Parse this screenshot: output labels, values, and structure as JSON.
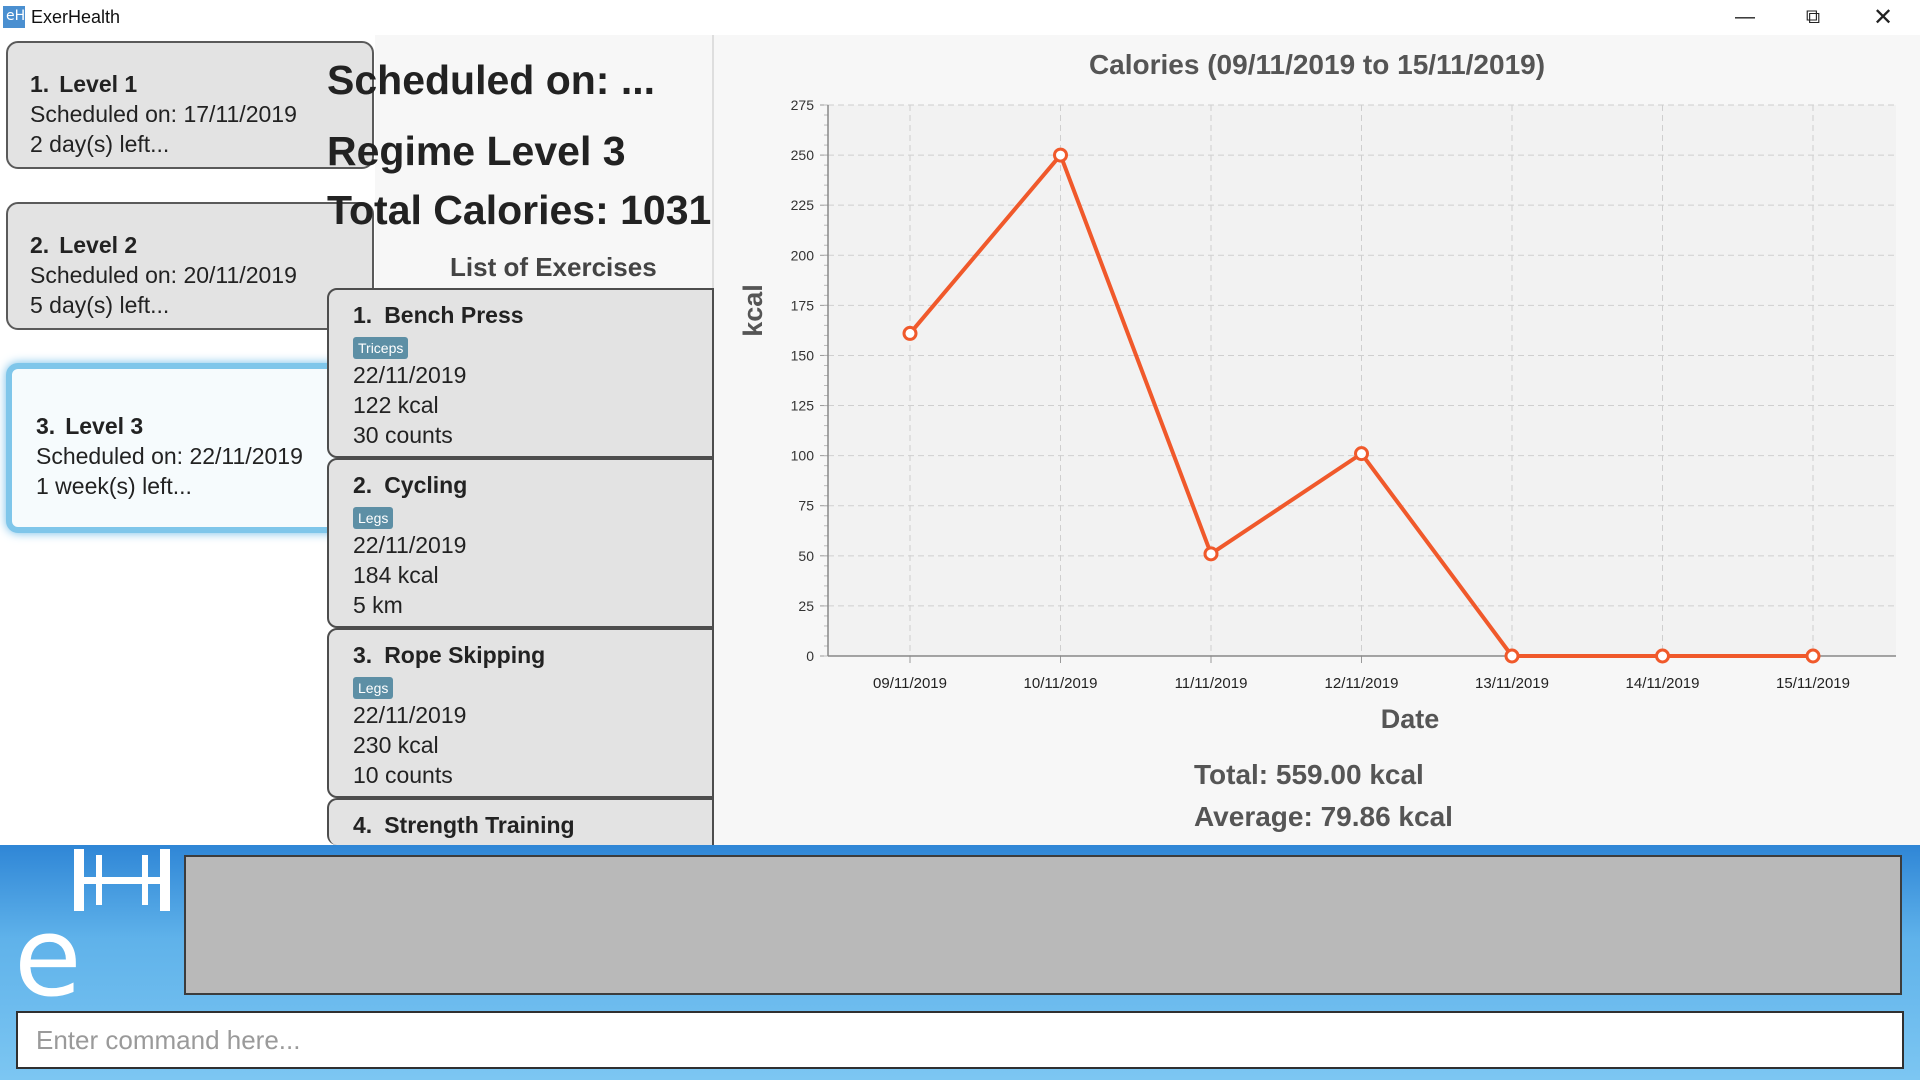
{
  "window": {
    "title": "ExerHealth",
    "icon_text": "eH"
  },
  "regimes": [
    {
      "index": "1.",
      "name": "Level 1",
      "scheduled": "Scheduled on: 17/11/2019",
      "remaining": "2 day(s) left..."
    },
    {
      "index": "2.",
      "name": "Level 2",
      "scheduled": "Scheduled on: 20/11/2019",
      "remaining": "5 day(s) left..."
    },
    {
      "index": "3.",
      "name": "Level 3",
      "scheduled": "Scheduled on: 22/11/2019",
      "remaining": "1 week(s) left..."
    }
  ],
  "detail": {
    "scheduled_heading": "Scheduled on: ...",
    "regime_name": "Regime Level 3",
    "total_calories": "Total Calories: 1031",
    "list_heading": "List of Exercises"
  },
  "exercises": [
    {
      "index": "1.",
      "name": "Bench Press",
      "tag": "Triceps",
      "date": "22/11/2019",
      "calories": "122 kcal",
      "quantity": "30 counts"
    },
    {
      "index": "2.",
      "name": "Cycling",
      "tag": "Legs",
      "date": "22/11/2019",
      "calories": "184 kcal",
      "quantity": "5 km"
    },
    {
      "index": "3.",
      "name": "Rope Skipping",
      "tag": "Legs",
      "date": "22/11/2019",
      "calories": "230 kcal",
      "quantity": "10 counts"
    },
    {
      "index": "4.",
      "name": "Strength Training",
      "tag": "",
      "date": "",
      "calories": "",
      "quantity": ""
    }
  ],
  "chart_data": {
    "type": "line",
    "title": "Calories (09/11/2019 to 15/11/2019)",
    "xlabel": "Date",
    "ylabel": "kcal",
    "categories": [
      "09/11/2019",
      "10/11/2019",
      "11/11/2019",
      "12/11/2019",
      "13/11/2019",
      "14/11/2019",
      "15/11/2019"
    ],
    "values": [
      161,
      250,
      51,
      101,
      0,
      0,
      0
    ],
    "ylim": [
      0,
      275
    ],
    "yticks": [
      0,
      25,
      50,
      75,
      100,
      125,
      150,
      175,
      200,
      225,
      250,
      275
    ],
    "grid": true,
    "line_color": "#f0592b"
  },
  "summary": {
    "total": "Total: 559.00 kcal",
    "average": "Average: 79.86 kcal"
  },
  "command": {
    "placeholder": "Enter command here..."
  }
}
